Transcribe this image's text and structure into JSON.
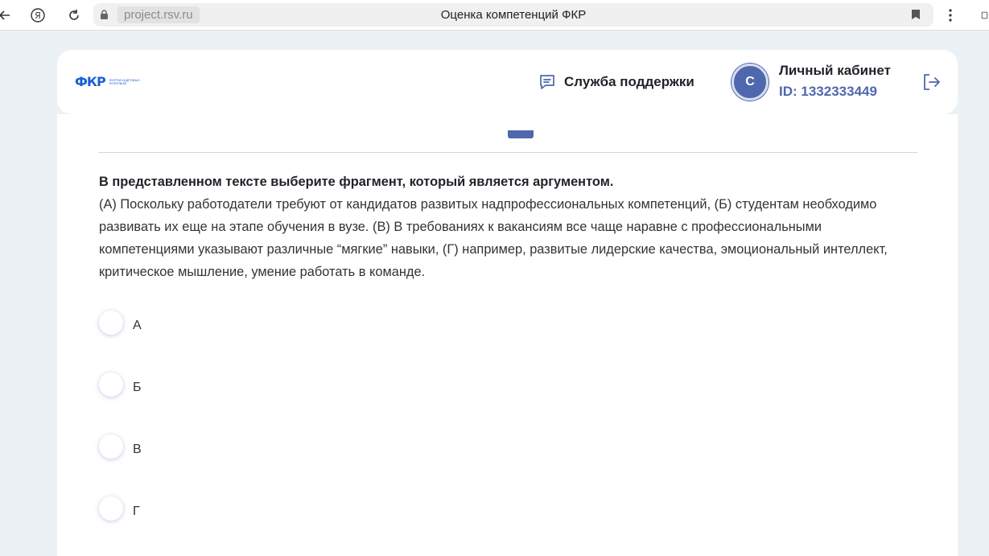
{
  "browser": {
    "url": "project.rsv.ru",
    "tab_title": "Оценка компетенций ФКР"
  },
  "header": {
    "logo_mark": "ФКР",
    "logo_text": "ФОРУМ КАДРОВЫХ РЕЗЕРВОВ",
    "support_label": "Служба поддержки",
    "avatar_initial": "С",
    "cabinet_title": "Личный кабинет",
    "cabinet_id": "ID: 1332333449"
  },
  "question": {
    "title": "В представленном тексте выберите фрагмент, который является аргументом.",
    "text": "(А) Поскольку работодатели требуют от кандидатов развитых надпрофессиональных компетенций, (Б) студентам необходимо развивать их еще на этапе обучения в вузе. (В) В требованиях к вакансиям все чаще наравне с профессиональными компетенциями указывают различные “мягкие” навыки, (Г) например, развитые лидерские качества, эмоциональный интеллект, критическое мышление, умение работать в команде.",
    "options": [
      {
        "label": "А"
      },
      {
        "label": "Б"
      },
      {
        "label": "В"
      },
      {
        "label": "Г"
      }
    ]
  },
  "colors": {
    "accent": "#4f67ad",
    "logo": "#1b5fd6",
    "background": "#ecf1f5"
  },
  "icons": [
    "back-icon",
    "yandex-icon",
    "reload-icon",
    "lock-icon",
    "bookmark-icon",
    "menu-icon",
    "chat-icon",
    "logout-icon"
  ]
}
